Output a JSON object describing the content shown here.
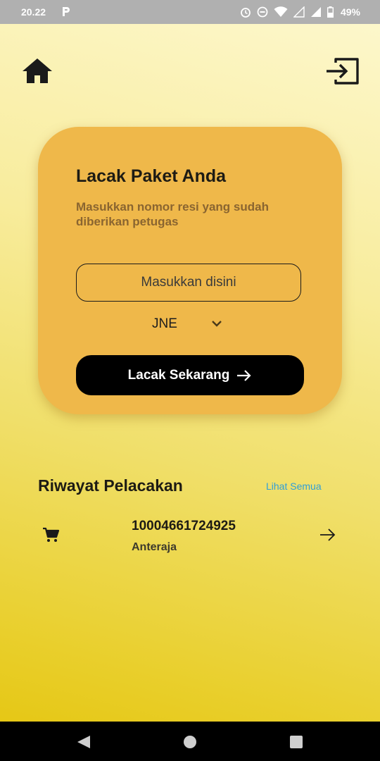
{
  "status_bar": {
    "time": "20.22",
    "battery": "49%"
  },
  "icons": {
    "home": "home-icon",
    "logout": "exit-icon",
    "cart": "cart-icon",
    "arrow": "arrow-right-icon",
    "chevron": "chevron-down-icon"
  },
  "card": {
    "title": "Lacak Paket Anda",
    "subtitle": "Masukkan nomor resi yang sudah diberikan petugas",
    "input_placeholder": "Masukkan disini",
    "input_value": "",
    "courier_selected": "JNE",
    "button_label": "Lacak Sekarang"
  },
  "history": {
    "title": "Riwayat Pelacakan",
    "see_all": "Lihat Semua",
    "items": [
      {
        "resi": "10004661724925",
        "courier": "Anteraja"
      }
    ]
  },
  "colors": {
    "card_bg": "#efb84a",
    "button_bg": "#000000",
    "link": "#2f9fd8"
  }
}
